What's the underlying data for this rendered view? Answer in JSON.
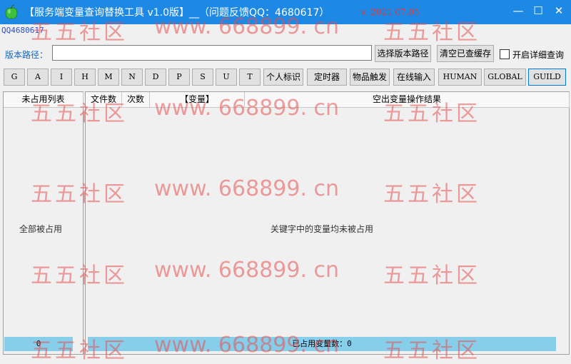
{
  "window": {
    "title": "【服务端变量查询替换工具 v1.0版】__（问题反馈QQ：4680617）",
    "version": "v. 2021.07.05",
    "minimize": "—",
    "maximize": "☐",
    "close": "✕"
  },
  "qq_label": "QQ4680617",
  "path": {
    "label": "版本路径：",
    "value": "",
    "placeholder": ""
  },
  "buttons": {
    "select_version_path": "选择版本路径",
    "clear_cache": "清空已查缓存",
    "detail_query_label": "开启详细查询"
  },
  "toolbar": {
    "letters": [
      "G",
      "A",
      "I",
      "H",
      "M",
      "N",
      "D",
      "P",
      "S",
      "U",
      "T"
    ],
    "personal_id": "个人标识",
    "timer": "定时器",
    "item_trigger": "物品触发",
    "online_input": "在线输入",
    "human": "HUMAN",
    "global": "GLOBAL",
    "guild": "GUILD"
  },
  "left_panel": {
    "header": "未占用列表",
    "empty_message": "全部被占用",
    "footer_count": "0"
  },
  "right_panel": {
    "headers": [
      "文件数",
      "次数",
      "【变量】",
      "空出变量操作结果"
    ],
    "empty_message": "关键字中的变量均未被占用",
    "footer_status": "已占用变量数：0"
  },
  "watermark": {
    "cn": "五五社区",
    "url": "www. 668899. cn"
  },
  "colors": {
    "titlebar": "#1e88e5",
    "footer_bar": "#87ceeb",
    "watermark": "#e55050",
    "path_label": "#1565c0",
    "version": "#e53935"
  }
}
